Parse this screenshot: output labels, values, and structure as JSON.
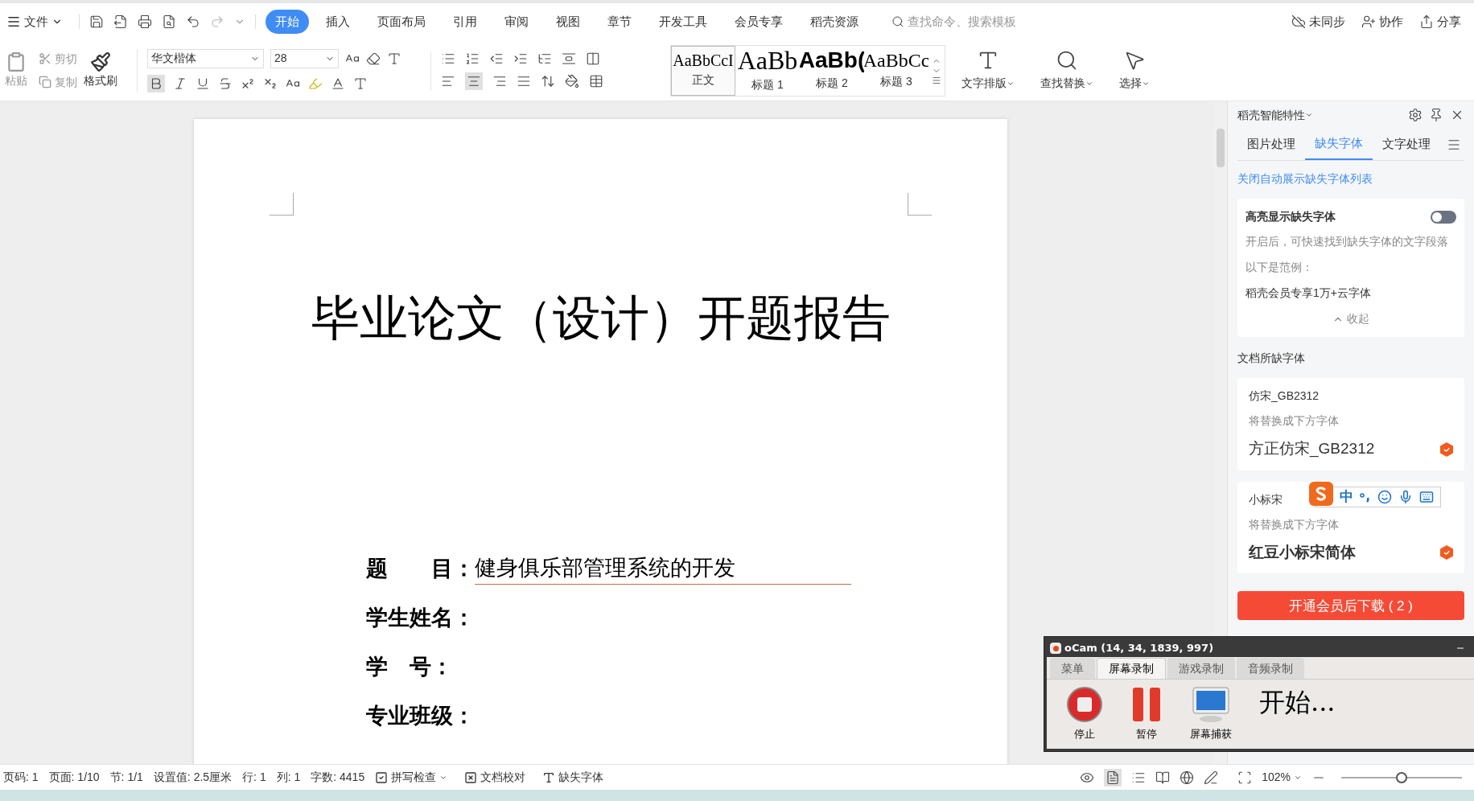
{
  "menu_bar": {
    "file_menu": "文件",
    "tabs": [
      {
        "label": "开始",
        "selected": true
      },
      {
        "label": "插入",
        "selected": false
      },
      {
        "label": "页面布局",
        "selected": false
      },
      {
        "label": "引用",
        "selected": false
      },
      {
        "label": "审阅",
        "selected": false
      },
      {
        "label": "视图",
        "selected": false
      },
      {
        "label": "章节",
        "selected": false
      },
      {
        "label": "开发工具",
        "selected": false
      },
      {
        "label": "会员专享",
        "selected": false
      },
      {
        "label": "稻壳资源",
        "selected": false
      }
    ],
    "search": {
      "placeholder": "查找命令、搜索模板"
    },
    "actions": [
      {
        "kind": "sync",
        "label": "未同步"
      },
      {
        "kind": "collab",
        "label": "协作"
      },
      {
        "kind": "share",
        "label": "分享"
      }
    ]
  },
  "ribbon": {
    "paste": "粘贴",
    "cut": "剪切",
    "copy": "复制",
    "format_painter": "格式刷",
    "font_name": "华文楷体",
    "font_size": "28",
    "styles": [
      {
        "preview": "AaBbCcI",
        "label": "正文",
        "kind": "normal",
        "selected": true
      },
      {
        "preview": "AaBb",
        "label": "标题 1",
        "kind": "h1",
        "selected": false
      },
      {
        "preview": "AaBb(",
        "label": "标题 2",
        "kind": "h2",
        "selected": false
      },
      {
        "preview": "AaBbCc",
        "label": "标题 3",
        "kind": "h3",
        "selected": false
      }
    ],
    "tools": [
      {
        "kind": "layout",
        "label": "文字排版"
      },
      {
        "kind": "find",
        "label": "查找替换"
      },
      {
        "kind": "select",
        "label": "选择"
      }
    ]
  },
  "document": {
    "title": "毕业论文（设计）开题报告",
    "fields": [
      {
        "label": "题　　目：",
        "value": "健身俱乐部管理系统的开发"
      },
      {
        "label": "学生姓名："
      },
      {
        "label": "学　号："
      },
      {
        "label": "专业班级："
      }
    ]
  },
  "side_panel": {
    "title": "稻壳智能特性",
    "tabs": [
      {
        "label": "图片处理",
        "selected": false
      },
      {
        "label": "缺失字体",
        "selected": true
      },
      {
        "label": "文字处理",
        "selected": false
      }
    ],
    "link": "关闭自动展示缺失字体列表",
    "highlight": {
      "label": "高亮显示缺失字体",
      "on": false,
      "description": "开启后，可快速找到缺失字体的文字段落",
      "example_label": "以下是范例：",
      "example": "稻壳会员专享1万+云字体",
      "collapse": "收起"
    },
    "section_title": "文档所缺字体",
    "fonts": [
      {
        "missing": "仿宋_GB2312",
        "hint": "将替换成下方字体",
        "replacement": "方正仿宋_GB2312"
      },
      {
        "missing": "小标宋",
        "hint": "将替换成下方字体",
        "replacement": "红豆小标宋简体"
      }
    ],
    "ime_toolbar": {
      "mode": "中"
    },
    "download_button": "开通会员后下载 ( 2 )"
  },
  "ocam": {
    "title": "oCam (14, 34, 1839, 997)",
    "tabs": [
      {
        "label": "菜单",
        "selected": false
      },
      {
        "label": "屏幕录制",
        "selected": true
      },
      {
        "label": "游戏录制",
        "selected": false
      },
      {
        "label": "音频录制",
        "selected": false
      }
    ],
    "buttons": [
      {
        "kind": "stop",
        "label": "停止"
      },
      {
        "kind": "pause",
        "label": "暂停"
      },
      {
        "kind": "capture",
        "label": "屏幕捕获"
      }
    ],
    "status": "开始..."
  },
  "status_bar": {
    "items": [
      "页码: 1",
      "页面: 1/10",
      "节: 1/1",
      "设置值: 2.5厘米",
      "行: 1",
      "列: 1",
      "字数: 4415"
    ],
    "spell_check": {
      "label": "拼写检查",
      "checked": true
    },
    "proofread": "文档校对",
    "missing_fonts": "缺失字体",
    "zoom": "102%",
    "zoom_slider": {
      "level": 0.5
    }
  }
}
